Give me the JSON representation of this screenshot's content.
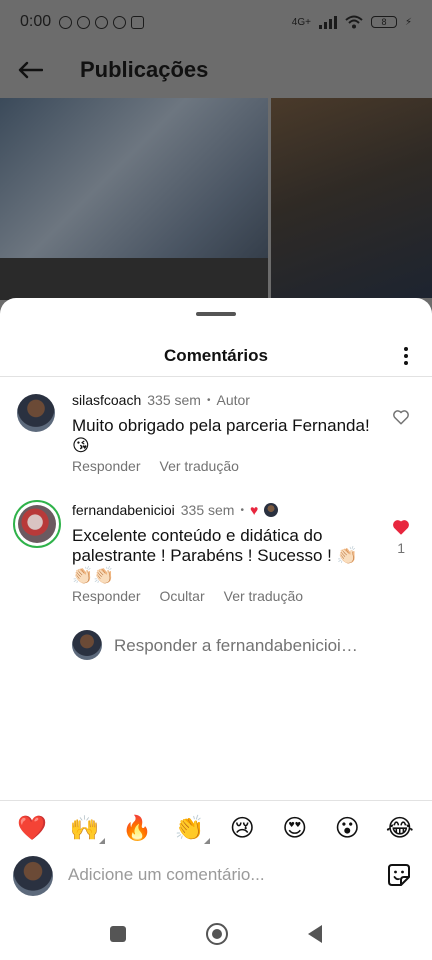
{
  "status_bar": {
    "time": "0:00",
    "network": "4G+",
    "battery": "8"
  },
  "header": {
    "title": "Publicações"
  },
  "sheet": {
    "title": "Comentários"
  },
  "comments": [
    {
      "username": "silasfcoach",
      "time": "335 sem",
      "badge": "Autor",
      "text": "Muito obrigado pela parceria Fernanda! 😘",
      "actions": [
        "Responder",
        "Ver tradução"
      ]
    },
    {
      "username": "fernandabenicioi",
      "time": "335 sem",
      "text": "Excelente conteúdo e didática do palestrante ! Parabéns ! Sucesso ! 👏🏻👏🏻👏🏻",
      "actions": [
        "Responder",
        "Ocultar",
        "Ver tradução"
      ],
      "likes": "1",
      "liked_color": "#e8263e"
    }
  ],
  "reply": {
    "placeholder": "Responder a fernandabenicioi…"
  },
  "emoji_bar": [
    "❤️",
    "🙌",
    "🔥",
    "👏",
    "😢",
    "😍",
    "😮",
    "😂"
  ],
  "composer": {
    "placeholder": "Adicione um comentário..."
  }
}
